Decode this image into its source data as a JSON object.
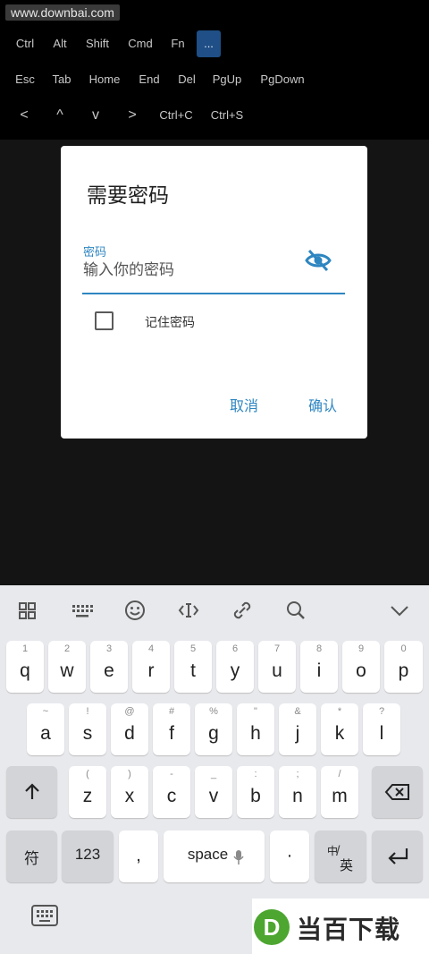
{
  "watermark": "www.downbai.com",
  "keybar": {
    "row1": [
      "Ctrl",
      "Alt",
      "Shift",
      "Cmd",
      "Fn",
      "..."
    ],
    "row2": [
      "Esc",
      "Tab",
      "Home",
      "End",
      "Del",
      "PgUp",
      "PgDown"
    ],
    "row3": [
      "<",
      "^",
      "v",
      ">",
      "Ctrl+C",
      "Ctrl+S"
    ]
  },
  "dialog": {
    "title": "需要密码",
    "field_label": "密码",
    "field_placeholder": "输入你的密码",
    "field_value": "",
    "remember_label": "记住密码",
    "remember_checked": false,
    "cancel": "取消",
    "confirm": "确认"
  },
  "keyboard": {
    "toolbar": [
      "grid-icon",
      "keyboard-icon",
      "emoji-icon",
      "cursor-icon",
      "clip-icon",
      "search-icon",
      "chevron-down-icon"
    ],
    "row1": [
      {
        "sup": "1",
        "main": "q"
      },
      {
        "sup": "2",
        "main": "w"
      },
      {
        "sup": "3",
        "main": "e"
      },
      {
        "sup": "4",
        "main": "r"
      },
      {
        "sup": "5",
        "main": "t"
      },
      {
        "sup": "6",
        "main": "y"
      },
      {
        "sup": "7",
        "main": "u"
      },
      {
        "sup": "8",
        "main": "i"
      },
      {
        "sup": "9",
        "main": "o"
      },
      {
        "sup": "0",
        "main": "p"
      }
    ],
    "row2": [
      {
        "sup": "~",
        "main": "a"
      },
      {
        "sup": "!",
        "main": "s"
      },
      {
        "sup": "@",
        "main": "d"
      },
      {
        "sup": "#",
        "main": "f"
      },
      {
        "sup": "%",
        "main": "g"
      },
      {
        "sup": "\"",
        "main": "h"
      },
      {
        "sup": "&",
        "main": "j"
      },
      {
        "sup": "*",
        "main": "k"
      },
      {
        "sup": "?",
        "main": "l"
      }
    ],
    "row3": [
      {
        "sup": "(",
        "main": "z"
      },
      {
        "sup": ")",
        "main": "x"
      },
      {
        "sup": "-",
        "main": "c"
      },
      {
        "sup": "_",
        "main": "v"
      },
      {
        "sup": ":",
        "main": "b"
      },
      {
        "sup": ";",
        "main": "n"
      },
      {
        "sup": "/",
        "main": "m"
      }
    ],
    "symbols": "符",
    "numbers": "123",
    "comma": ",",
    "space": "space",
    "period": "·",
    "lang_top": "中",
    "lang_bottom": "英"
  },
  "brand": {
    "logo_letter": "D",
    "name": "当百下载"
  },
  "colors": {
    "accent": "#2e86c1",
    "brand_green": "#4da630"
  }
}
